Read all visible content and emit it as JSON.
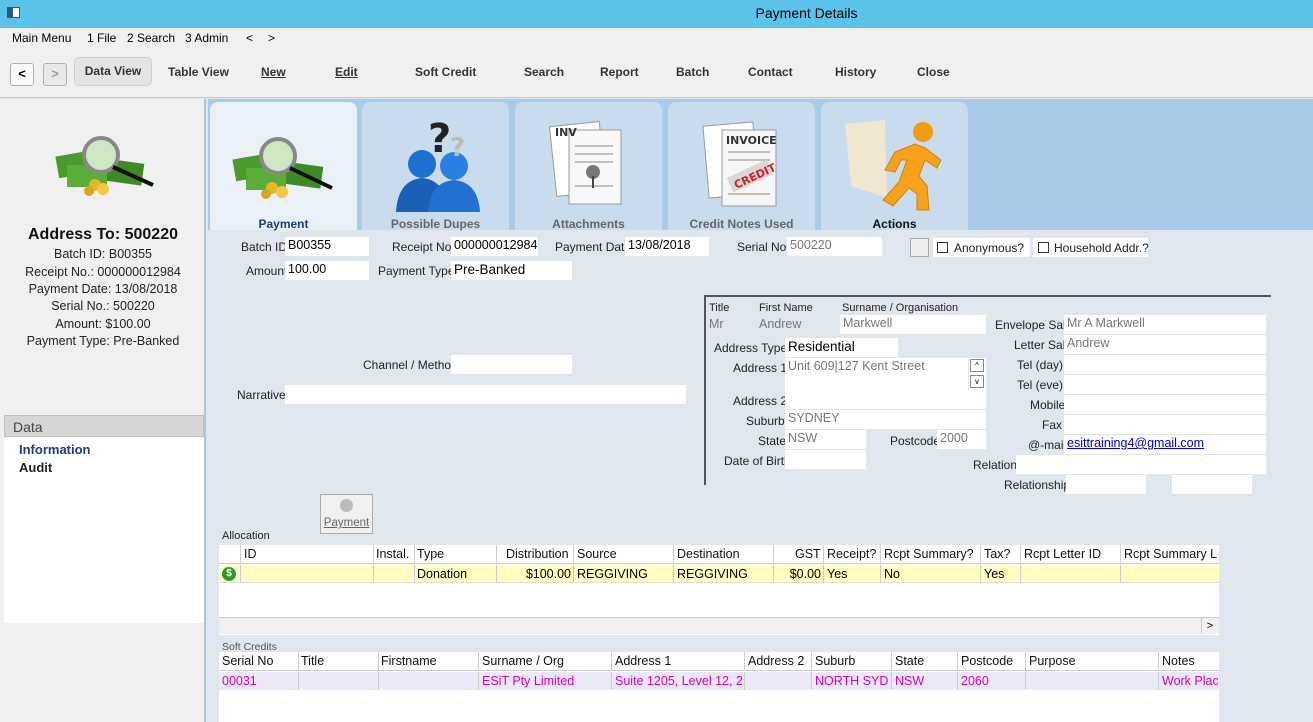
{
  "window": {
    "title": "Payment Details"
  },
  "menu": [
    "Main Menu",
    "1 File",
    "2 Search",
    "3 Admin",
    "<",
    ">"
  ],
  "toolbar": {
    "back": "<",
    "forward": ">",
    "buttons": [
      "Data View",
      "Table View",
      "New",
      "Edit",
      "Soft Credit",
      "Search",
      "Report",
      "Batch",
      "Contact",
      "History",
      "Close"
    ]
  },
  "summary": {
    "address_to": "Address To: 500220",
    "batch_id": "Batch ID: B00355",
    "receipt_no": "Receipt No.: 000000012984",
    "payment_date": "Payment Date: 13/08/2018",
    "serial_no": "Serial No.: 500220",
    "amount": "Amount: $100.00",
    "payment_type": "Payment Type: Pre-Banked"
  },
  "sidebar": {
    "header": "Data",
    "items": [
      "Information",
      "Audit"
    ]
  },
  "tabs": [
    {
      "label": "Payment",
      "icon": "money-magnifier-icon"
    },
    {
      "label": "Possible Dupes",
      "icon": "question-people-icon"
    },
    {
      "label": "Attachments",
      "icon": "attachment-documents-icon"
    },
    {
      "label": "Credit Notes Used",
      "icon": "credit-invoice-icon"
    },
    {
      "label": "Actions",
      "icon": "running-man-icon"
    }
  ],
  "form": {
    "batch_id_label": "Batch ID",
    "batch_id": "B00355",
    "receipt_no_label": "Receipt No.",
    "receipt_no": "000000012984",
    "payment_date_label": "Payment Date",
    "payment_date": "13/08/2018",
    "serial_no_label": "Serial No.",
    "serial_no": "500220",
    "anonymous_label": "Anonymous?",
    "household_label": "Household Addr.?",
    "amount_label": "Amount",
    "amount": "100.00",
    "payment_type_label": "Payment Type",
    "payment_type": "Pre-Banked",
    "channel_label": "Channel / Method",
    "channel": "",
    "narrative_label": "Narrative",
    "narrative": "",
    "payment_button": "Payment"
  },
  "contact": {
    "title_label": "Title",
    "first_name_label": "First Name",
    "surname_label": "Surname / Organisation",
    "title": "Mr",
    "first_name": "Andrew",
    "surname": "Markwell",
    "address_type_label": "Address Type",
    "address_type": "Residential",
    "address1_label": "Address 1",
    "address1": "Unit 609|127 Kent Street",
    "address2_label": "Address 2",
    "address2": "",
    "suburb_label": "Suburb",
    "suburb": "SYDNEY",
    "state_label": "State",
    "state": "NSW",
    "postcode_label": "Postcode",
    "postcode": "2000",
    "dob_label": "Date of Birth",
    "dob": "",
    "envelope_label": "Envelope Sal.",
    "envelope": "Mr A Markwell",
    "letter_label": "Letter Sal.",
    "letter": "Andrew",
    "tel_day_label": "Tel (day)",
    "tel_eve_label": "Tel (eve)",
    "mobile_label": "Mobile",
    "fax_label": "Fax",
    "email_label": "@-mail",
    "email": "esittraining4@gmail.com",
    "relation_label": "Relation",
    "relationship_label": "Relationship"
  },
  "allocation": {
    "title": "Allocation",
    "columns": [
      "ID",
      "Instal.",
      "Type",
      "Distribution",
      "Source",
      "Destination",
      "GST",
      "Receipt?",
      "Rcpt Summary?",
      "Tax?",
      "Rcpt Letter ID",
      "Rcpt Summary L"
    ],
    "rows": [
      {
        "id": "",
        "instal": "",
        "type": "Donation",
        "distribution": "$100.00",
        "source": "REGGIVING",
        "destination": "REGGIVING",
        "gst": "$0.00",
        "receipt": "Yes",
        "rcpt_summary": "No",
        "tax": "Yes",
        "letter_id": "",
        "summary_l": ""
      }
    ]
  },
  "soft_credits": {
    "title": "Soft Credits",
    "columns": [
      "Serial No",
      "Title",
      "Firstname",
      "Surname / Org",
      "Address 1",
      "Address 2",
      "Suburb",
      "State",
      "Postcode",
      "Purpose",
      "Notes"
    ],
    "rows": [
      {
        "serial": "00031",
        "title": "",
        "firstname": "",
        "surname": "ESiT Pty Limited",
        "address1": "Suite 1205, Level 12, 2",
        "address2": "",
        "suburb": "NORTH SYD",
        "state": "NSW",
        "postcode": "2060",
        "purpose": "",
        "notes": "Work Plac"
      }
    ]
  },
  "colors": {
    "titlebar": "#5bc3ea",
    "tab_active": "#1b3c82",
    "row_highlight": "#ffffc0",
    "soft_credit_text": "#d100c8"
  }
}
